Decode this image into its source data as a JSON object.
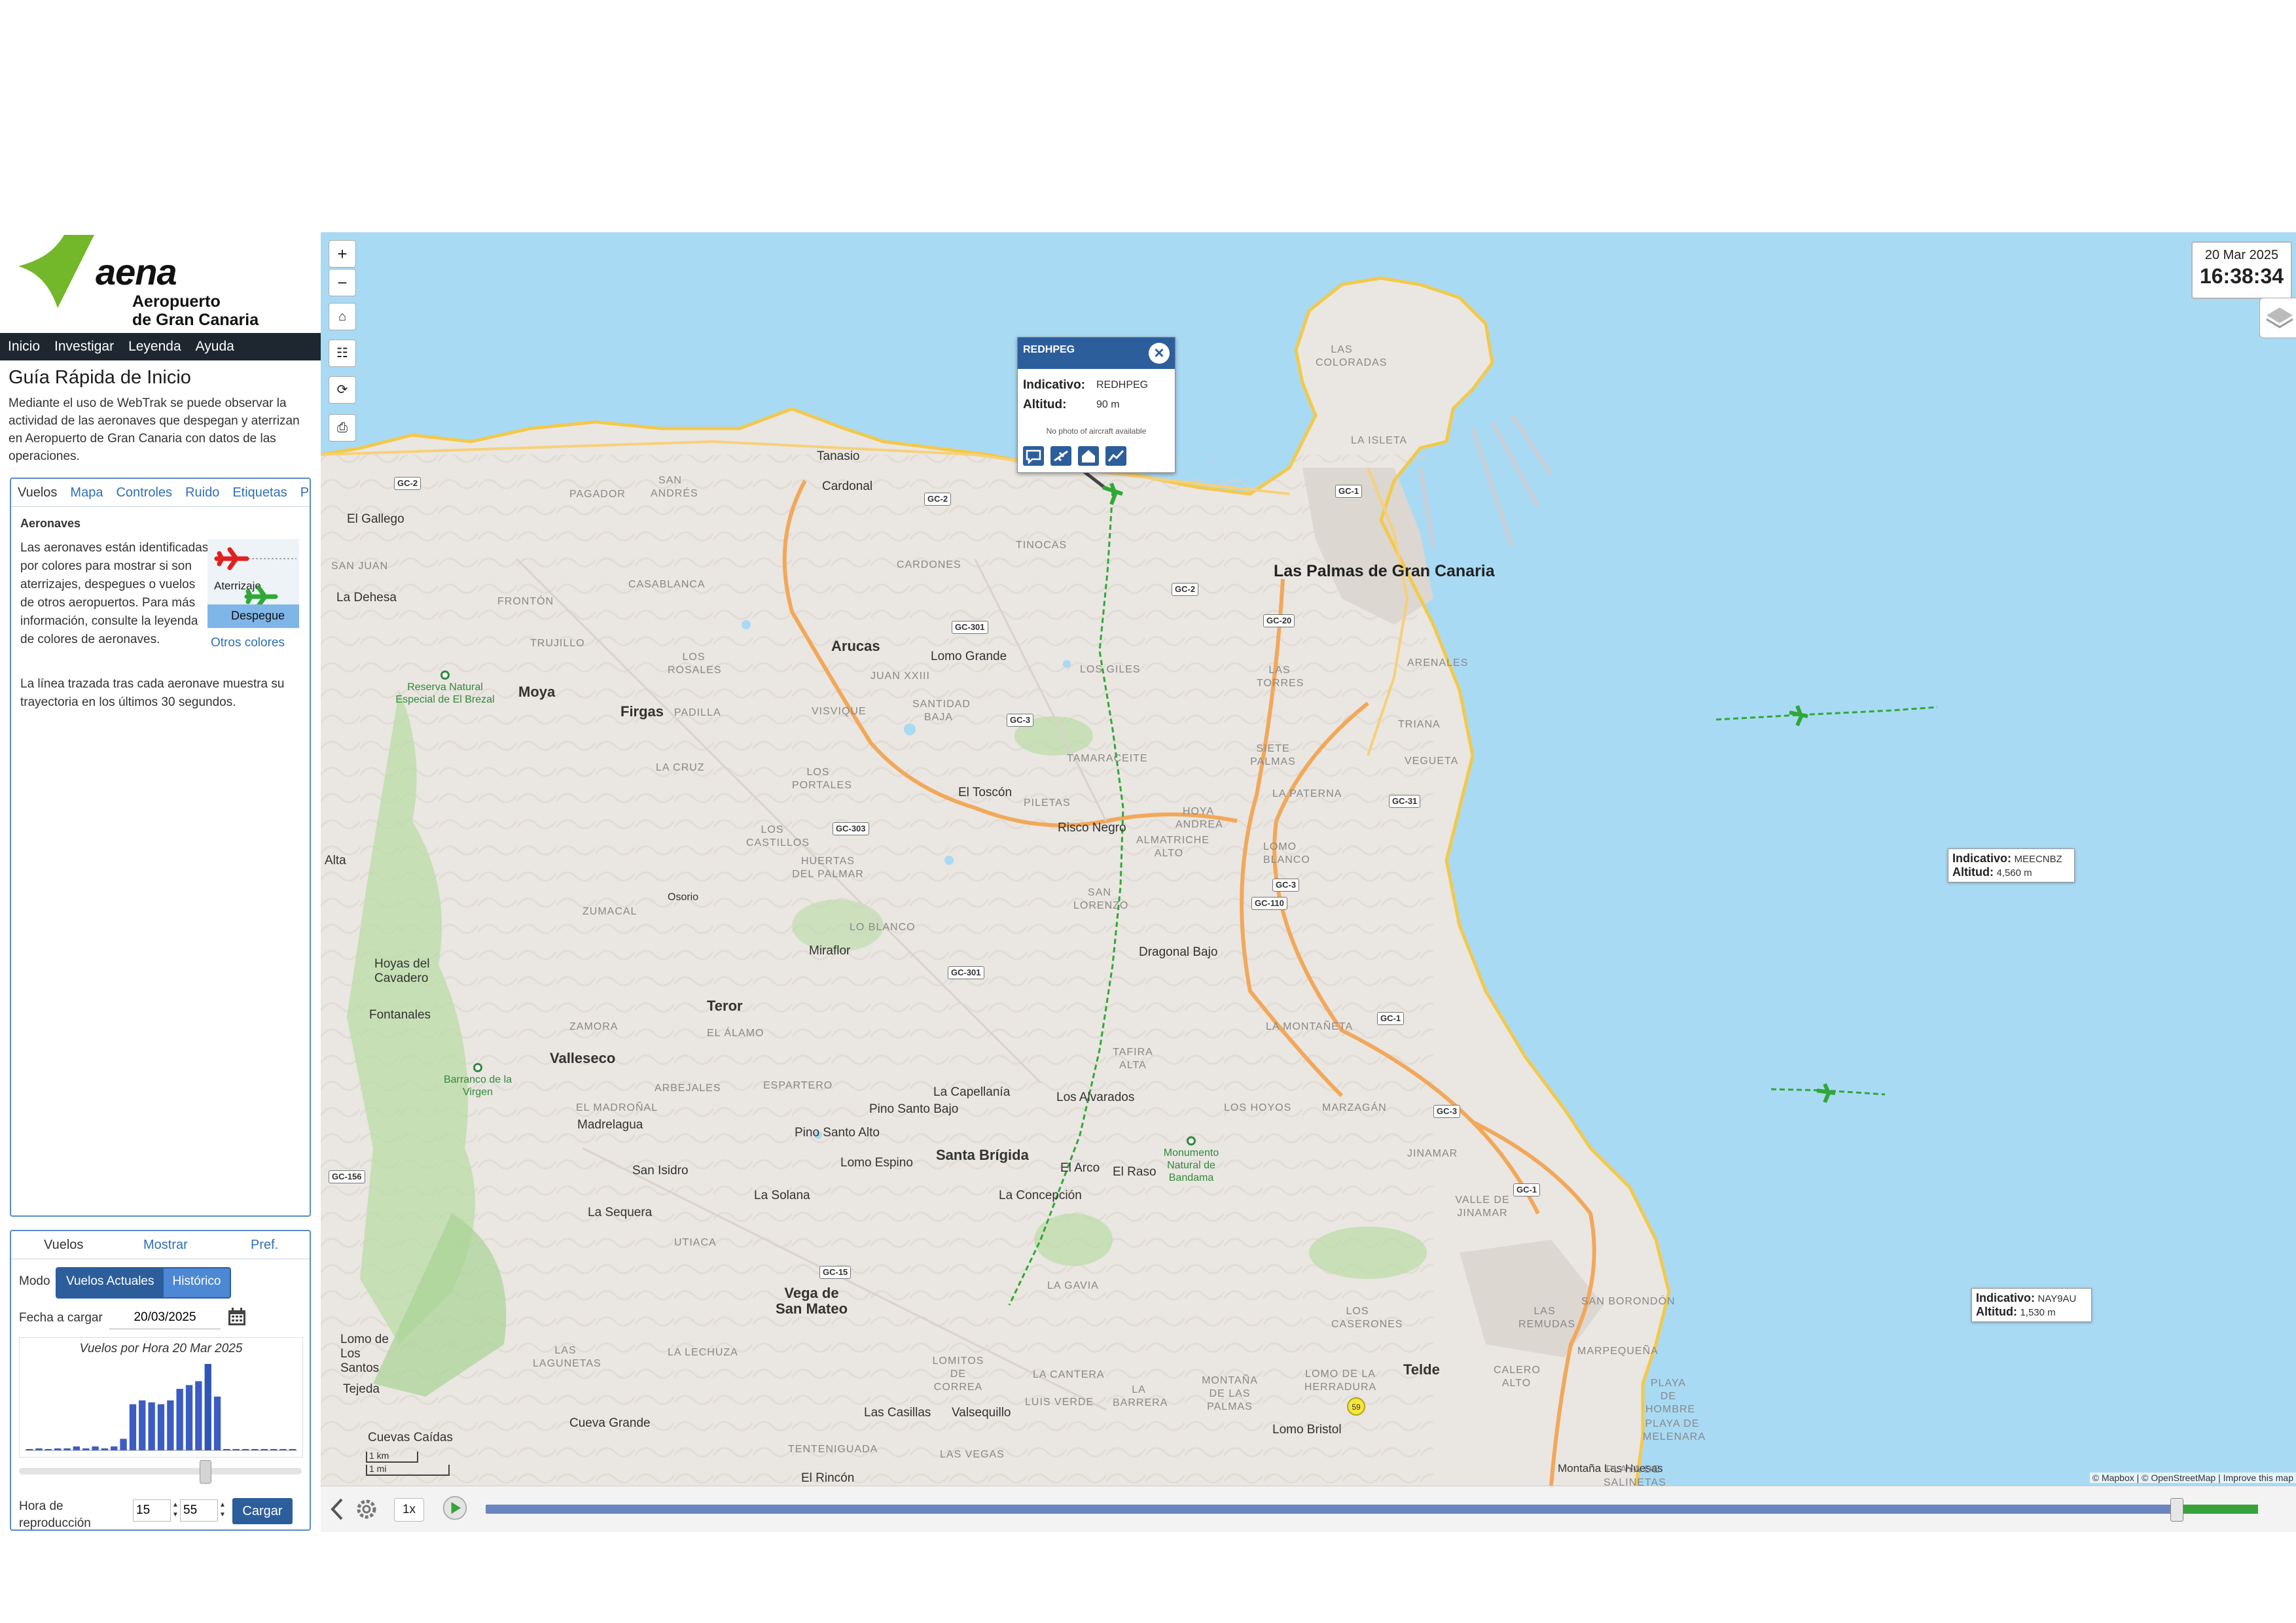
{
  "brand": {
    "logo_text": "aena",
    "subtitle_line1": "Aeropuerto",
    "subtitle_line2": "de Gran Canaria",
    "brand_green": "#73b72b"
  },
  "nav": {
    "items": [
      "Inicio",
      "Investigar",
      "Leyenda",
      "Ayuda"
    ]
  },
  "guide": {
    "title": "Guía Rápida de Inicio",
    "text": "Mediante el uso de WebTrak se puede observar la actividad de las aeronaves que despegan y aterrizan en Aeropuerto de Gran Canaria con datos de las operaciones."
  },
  "info_panel": {
    "tabs": [
      "Vuelos",
      "Mapa",
      "Controles",
      "Ruido",
      "Etiquetas",
      "Paneles"
    ],
    "heading": "Aeronaves",
    "paragraph1": "Las aeronaves están identificadas por colores para mostrar si son aterrizajes, despegues o vuelos de otros aeropuertos. Para más información, consulte la leyenda de colores de aeronaves.",
    "paragraph2": "La línea trazada tras cada aeronave muestra su trayectoria en los últimos 30 segundos.",
    "legend_landing": "Aterrizaje",
    "legend_takeoff": "Despegue",
    "other_colors_link": "Otros colores",
    "landing_color": "#e02020",
    "takeoff_color": "#2fa836"
  },
  "control_panel": {
    "tabs": [
      "Vuelos",
      "Mostrar",
      "Pref."
    ],
    "mode_label": "Modo",
    "mode_current": "Vuelos Actuales",
    "mode_history": "Histórico",
    "date_label": "Fecha a cargar",
    "date_value": "20/03/2025",
    "histogram_title": "Vuelos por Hora 20 Mar 2025",
    "histogram_values": [
      0,
      1,
      0,
      1,
      1,
      2,
      1,
      2,
      1,
      2,
      6,
      24,
      26,
      25,
      24,
      26,
      32,
      34,
      36,
      45,
      28,
      0,
      0,
      0,
      0,
      0,
      0,
      0,
      0
    ],
    "histogram_highlight_index": 19,
    "playback_label": "Hora de reproducción",
    "hour_value": "15",
    "minute_value": "55",
    "load_button": "Cargar"
  },
  "map": {
    "controls": [
      "zoom-in",
      "zoom-out",
      "home",
      "group",
      "refresh",
      "print"
    ],
    "clock_date": "20 Mar 2025",
    "clock_time": "16:38:34",
    "places": [
      "Las Palmas de Gran Canaria",
      "Arucas",
      "Moya",
      "Firgas",
      "Teror",
      "Valleseco",
      "Santa Brígida",
      "Vega de San Mateo",
      "Telde",
      "Tanasio",
      "Cardonal",
      "El Gallego",
      "La Dehesa",
      "Lomo Grande",
      "El Toscón",
      "Risco Negro",
      "Dragonal Bajo",
      "Miraflor",
      "Hoyas del Cavadero",
      "Fontanales",
      "Madrelagua",
      "San Isidro",
      "La Sequera",
      "La Solana",
      "Pino Santo Bajo",
      "Pino Santo Alto",
      "La Capellanía",
      "Los Alvarados",
      "Lomo Espino",
      "El Arco",
      "El Raso",
      "La Concepción",
      "Lomo de Los Santos",
      "Tejeda",
      "Cuevas Caídas",
      "Cueva Grande",
      "Las Casillas",
      "Valsequillo",
      "Lomo Bristol",
      "El Rincón",
      "Montaña Las Huesas",
      "Osorio",
      "Alta"
    ],
    "districts": [
      "LAS COLORADAS",
      "LA ISLETA",
      "ARENALES",
      "TRIANA",
      "VEGUETA",
      "SIETE PALMAS",
      "LAS TORRES",
      "LA PATERNA",
      "LOMO BLANCO",
      "HOYA ANDREA",
      "TAMARACEITE",
      "LOS GILES",
      "TINOCAS",
      "CARDONES",
      "JUAN XXIII",
      "SANTIDAD BAJA",
      "VISVIQUE",
      "LOS ROSALES",
      "PADILLA",
      "LA CRUZ",
      "LOS PORTALES",
      "LOS CASTILLOS",
      "HUERTAS DEL PALMAR",
      "LO BLANCO",
      "SAN LORENZO",
      "ALMATRICHE ALTO",
      "PILETAS",
      "TRUJILLO",
      "FRONTÓN",
      "CASABLANCA",
      "SAN ANDRÉS",
      "PAGADOR",
      "SAN JUAN",
      "ZUMACAL",
      "EL ÁLAMO",
      "ZAMORA",
      "ARBEJALES",
      "ESPARTERO",
      "EL MADROÑAL",
      "TAFIRA ALTA",
      "LA MONTAÑETA",
      "LOS HOYOS",
      "MARZAGÁN",
      "JINAMAR",
      "VALLE DE JINAMAR",
      "LAS REMUDAS",
      "SAN BORONDÓN",
      "MARPEQUEÑA",
      "CALERO ALTO",
      "LOS CASERONES",
      "LOMO DE LA HERRADURA",
      "MONTAÑA DE LAS PALMAS",
      "LA BARRERA",
      "LA CANTERA",
      "LOMITOS DE CORREA",
      "LA GAVIA",
      "LUIS VERDE",
      "TENTENIGUADA",
      "LAS VEGAS",
      "LAS LAGUNETAS",
      "LA LECHUZA",
      "UTIACA",
      "PLAYA DE HOMBRE",
      "PLAYA DE MELENARA",
      "PLAYA DE SALINETAS"
    ],
    "roads": [
      "GC-2",
      "GC-2",
      "GC-2",
      "GC-1",
      "GC-20",
      "GC-301",
      "GC-3",
      "GC-303",
      "GC-31",
      "GC-3",
      "GC-110",
      "GC-301",
      "GC-1",
      "GC-3",
      "GC-1",
      "GC-15",
      "GC-156"
    ],
    "parks": [
      "Reserva Natural Especial de El Brezal",
      "Barranco de la Virgen",
      "Monumento Natural de Bandama"
    ],
    "popup": {
      "callsign": "REDHPEG",
      "label_callsign": "Indicativo:",
      "value_callsign": "REDHPEG",
      "label_altitude": "Altitud:",
      "value_altitude": "90 m",
      "photo_note": "No photo of aircraft available"
    },
    "flights": [
      {
        "label_callsign": "Indicativo:",
        "callsign": "MEECNBZ",
        "label_altitude": "Altitud:",
        "altitude": "4,560 m"
      },
      {
        "label_callsign": "Indicativo:",
        "callsign": "NAY9AU",
        "label_altitude": "Altitud:",
        "altitude": "1,530 m"
      }
    ],
    "noise_monitor": "59",
    "scale_km": "1 km",
    "scale_mi": "1 mi",
    "attribution": "© Mapbox | © OpenStreetMap | Improve this map",
    "sea_color": "#a9daf4",
    "land_color": "#eae6e1",
    "track_color": "#2fa836"
  },
  "playback": {
    "speed": "1x"
  }
}
